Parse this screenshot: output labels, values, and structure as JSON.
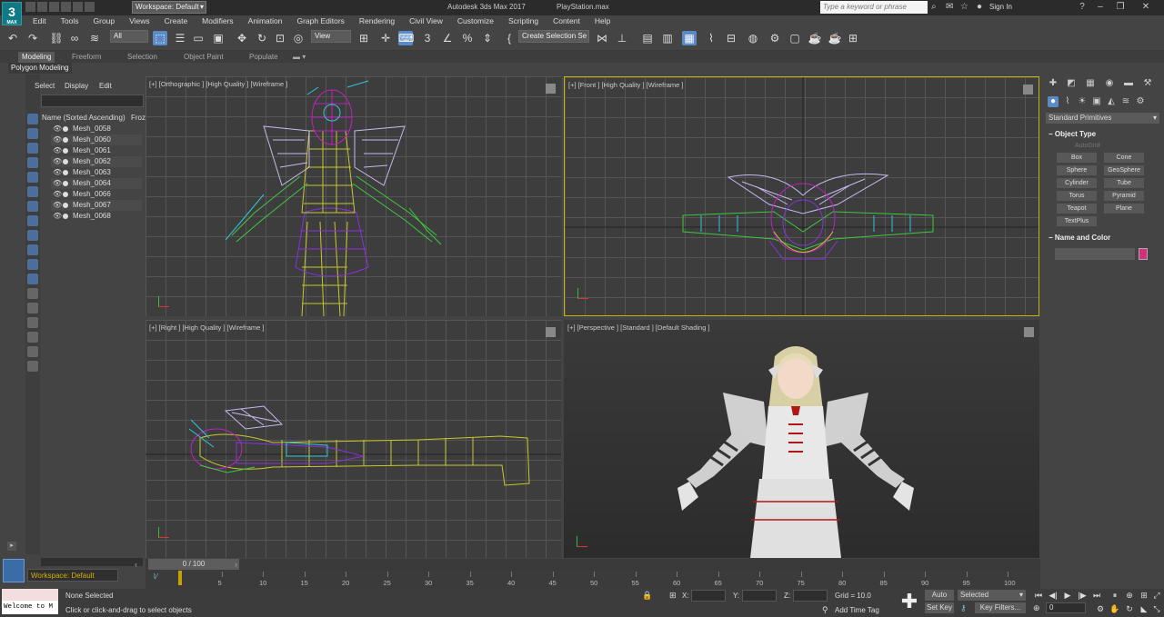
{
  "titlebar": {
    "logo_text": "3",
    "logo_sub": "MAX",
    "workspace": "Workspace: Default",
    "app_title": "Autodesk 3ds Max 2017",
    "file_title": "PlayStation.max",
    "search_placeholder": "Type a keyword or phrase",
    "sign_in": "Sign In"
  },
  "menu": [
    "Edit",
    "Tools",
    "Group",
    "Views",
    "Create",
    "Modifiers",
    "Animation",
    "Graph Editors",
    "Rendering",
    "Civil View",
    "Customize",
    "Scripting",
    "Content",
    "Help"
  ],
  "toolbar": {
    "filter_dropdown": "All",
    "refcoord_dropdown": "View",
    "selection_set": "Create Selection Se"
  },
  "ribbon": {
    "tabs": [
      "Modeling",
      "Freeform",
      "Selection",
      "Object Paint",
      "Populate"
    ],
    "active_tab": "Modeling",
    "panel_label": "Polygon Modeling"
  },
  "explorer": {
    "tabs": [
      "Select",
      "Display",
      "Edit"
    ],
    "header": "Name (Sorted Ascending)",
    "header_col2": "Froz",
    "items": [
      "Mesh_0058",
      "Mesh_0060",
      "Mesh_0061",
      "Mesh_0062",
      "Mesh_0063",
      "Mesh_0064",
      "Mesh_0066",
      "Mesh_0067",
      "Mesh_0068"
    ]
  },
  "viewports": {
    "top_left": "[+] [Orthographic ] [High Quality ] [Wireframe ]",
    "top_right": "[+] [Front ] [High Quality ] [Wireframe ]",
    "bottom_left": "[+] [Right ] [High Quality ] [Wireframe ]",
    "bottom_right": "[+] [Perspective ] [Standard ] [Default Shading ]"
  },
  "command_panel": {
    "category": "Standard Primitives",
    "object_type_title": "Object Type",
    "autogrid": "AutoGrid",
    "primitives": [
      "Box",
      "Cone",
      "Sphere",
      "GeoSphere",
      "Cylinder",
      "Tube",
      "Torus",
      "Pyramid",
      "Teapot",
      "Plane",
      "TextPlus"
    ],
    "name_color_title": "Name and Color",
    "object_color": "#d0307c"
  },
  "timeline": {
    "slider_label": "0 / 100",
    "ticks": [
      5,
      10,
      15,
      20,
      25,
      30,
      35,
      40,
      45,
      50,
      55,
      60,
      65,
      70,
      75,
      80,
      85,
      90,
      95,
      100
    ]
  },
  "status": {
    "maxscript": "Welcome to M",
    "workspace": "Workspace: Default",
    "selection": "None Selected",
    "prompt": "Click or click-and-drag to select objects",
    "x_label": "X:",
    "y_label": "Y:",
    "z_label": "Z:",
    "grid": "Grid = 10.0",
    "add_time_tag": "Add Time Tag",
    "auto_key": "Auto Key",
    "set_key": "Set Key",
    "selected": "Selected",
    "key_filters": "Key Filters...",
    "frame": "0"
  },
  "colors": {
    "accent": "#5b8bc7",
    "viewport_border_active": "#c8b400",
    "wire_yellow": "#c8c82a",
    "wire_magenta": "#c020c0",
    "wire_cyan": "#30c8d8",
    "wire_purple": "#8a30e0",
    "wire_lilac": "#c8b8f0",
    "wire_green": "#3ec83e"
  }
}
